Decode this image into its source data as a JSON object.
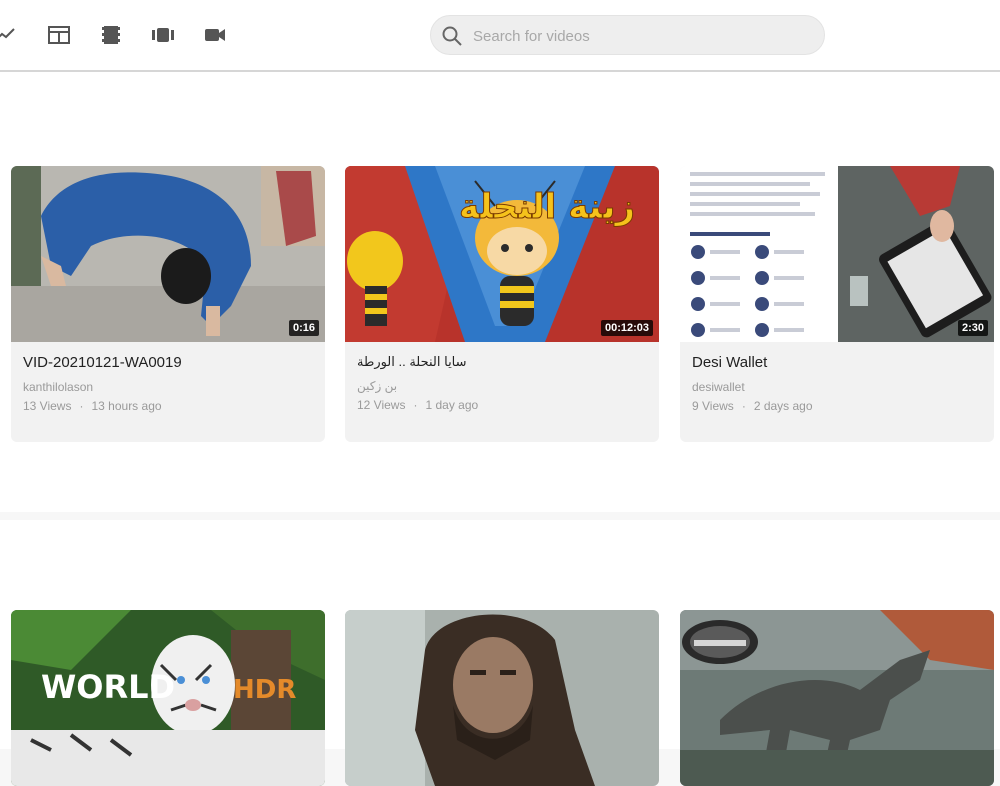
{
  "header": {
    "nav_icons": [
      "trending-icon",
      "layout-icon",
      "film-strip-icon",
      "video-carousel-icon",
      "video-camera-icon"
    ],
    "search": {
      "placeholder": "Search for videos",
      "value": ""
    }
  },
  "videos": [
    {
      "title": "VID-20210121-WA0019",
      "channel": "kanthilolason",
      "views": "13 Views",
      "age": "13 hours ago",
      "duration": "0:16"
    },
    {
      "title": "سايا النحلة .. الورطة",
      "channel": "بن زكين",
      "views": "12 Views",
      "age": "1 day ago",
      "duration": "00:12:03",
      "thumb_text": "زينة النحلة"
    },
    {
      "title": "Desi Wallet",
      "channel": "desiwallet",
      "views": "9 Views",
      "age": "2 days ago",
      "duration": "2:30"
    },
    {
      "thumb_text_left": "WORLD",
      "thumb_text_right": "HDR"
    },
    {},
    {}
  ],
  "colors": {
    "accent": "#3c6df0",
    "card_bg": "#f2f2f2",
    "page_bg": "#f7f7f7"
  }
}
